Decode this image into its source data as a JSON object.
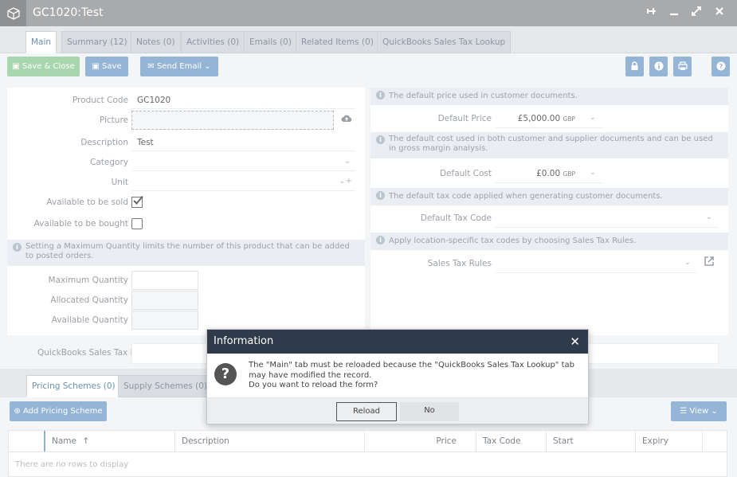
{
  "window": {
    "title": "GC1020:Test"
  },
  "tabs": [
    {
      "label": "Main"
    },
    {
      "label": "Summary (12)"
    },
    {
      "label": "Notes (0)"
    },
    {
      "label": "Activities (0)"
    },
    {
      "label": "Emails (0)"
    },
    {
      "label": "Related Items (0)"
    },
    {
      "label": "QuickBooks Sales Tax Lookup"
    }
  ],
  "toolbar": {
    "save_close": "Save & Close",
    "save": "Save",
    "send_email": "Send Email"
  },
  "left": {
    "product_code_label": "Product Code",
    "product_code_value": "GC1020",
    "picture_label": "Picture",
    "description_label": "Description",
    "description_value": "Test",
    "category_label": "Category",
    "unit_label": "Unit",
    "available_sold_label": "Available to be sold",
    "available_bought_label": "Available to be bought",
    "max_qty_info": "Setting a Maximum Quantity limits the number of this product that can be added to posted orders.",
    "maximum_quantity_label": "Maximum Quantity",
    "allocated_quantity_label": "Allocated Quantity",
    "available_quantity_label": "Available Quantity"
  },
  "right": {
    "price_info": "The default price used in customer documents.",
    "default_price_label": "Default Price",
    "default_price_value": "£5,000.00",
    "currency": "GBP",
    "cost_info": "The default cost used in both customer and supplier documents and can be used in gross margin analysis.",
    "default_cost_label": "Default Cost",
    "default_cost_value": "£0.00",
    "tax_info": "The default tax code applied when generating customer documents.",
    "default_tax_code_label": "Default Tax Code",
    "sales_tax_info": "Apply location-specific tax codes by choosing Sales Tax Rules.",
    "sales_tax_rules_label": "Sales Tax Rules"
  },
  "quickbooks": {
    "label": "QuickBooks Sales Tax Id"
  },
  "bottom_tabs": [
    {
      "label": "Pricing Schemes (0)"
    },
    {
      "label": "Supply Schemes (0)"
    }
  ],
  "add_pricing_scheme": "Add Pricing Scheme",
  "view_button": "View",
  "table": {
    "columns": [
      "Name",
      "Description",
      "Price",
      "Tax Code",
      "Start",
      "Expiry"
    ],
    "empty": "There are no rows to display"
  },
  "dialog": {
    "title": "Information",
    "line1": "The \"Main\" tab must be reloaded because the \"QuickBooks Sales Tax Lookup\" tab may have modified the record.",
    "line2": "Do you want to reload the form?",
    "reload": "Reload",
    "no": "No"
  }
}
